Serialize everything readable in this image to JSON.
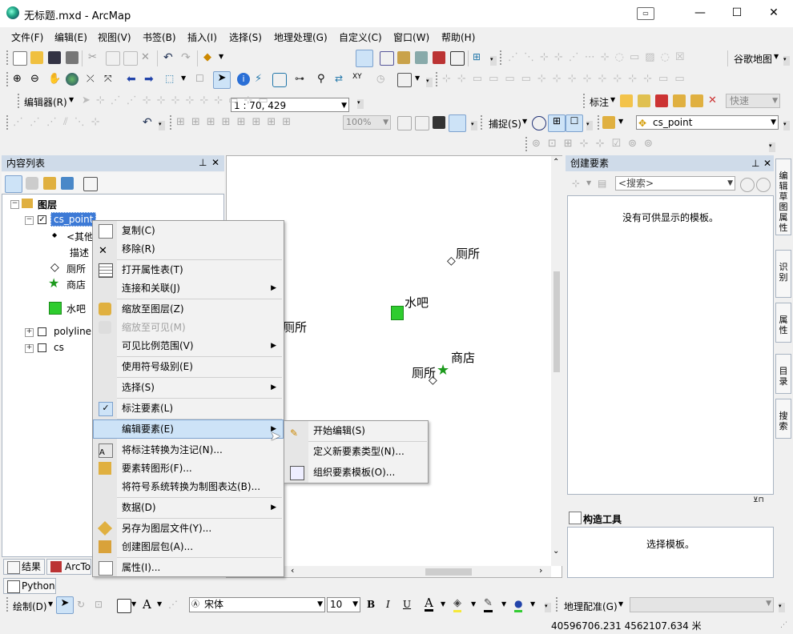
{
  "window": {
    "title": "无标题.mxd - ArcMap",
    "minimize": "—",
    "maximize": "☐",
    "close": "✕"
  },
  "menu": [
    "文件(F)",
    "编辑(E)",
    "视图(V)",
    "书签(B)",
    "插入(I)",
    "选择(S)",
    "地理处理(G)",
    "自定义(C)",
    "窗口(W)",
    "帮助(H)"
  ],
  "toolbar": {
    "scale": "1 : 70, 429",
    "basemap": "谷歌地图",
    "editor": "编辑器(R)",
    "label": "标注",
    "label_speed": "快速",
    "snapping": "捕捉(S)",
    "layer_select": "cs_point",
    "zoom_pct": "100%"
  },
  "toc": {
    "title": "内容列表",
    "pin": "ᵖ",
    "close": "✕",
    "root": "图层",
    "layers": [
      {
        "name": "cs_point",
        "checked": true,
        "expanded": true
      },
      {
        "name": "polyline",
        "checked": false,
        "expanded": false
      },
      {
        "name": "cs",
        "checked": false,
        "expanded": false
      }
    ],
    "legend": {
      "other": "<其他",
      "desc": "描述",
      "toilet": "厕所",
      "shop": "商店",
      "water": "水吧"
    }
  },
  "map": {
    "labels": {
      "toilet1": "厕所",
      "water": "水吧",
      "toilet2": "厕所",
      "shop": "商店",
      "toilet3": "厕所"
    }
  },
  "context_menu": {
    "items": [
      {
        "label": "复制(C)"
      },
      {
        "label": "移除(R)"
      },
      {
        "label": "打开属性表(T)"
      },
      {
        "label": "连接和关联(J)"
      },
      {
        "label": "缩放至图层(Z)"
      },
      {
        "label": "缩放至可见(M)"
      },
      {
        "label": "可见比例范围(V)"
      },
      {
        "label": "使用符号级别(E)"
      },
      {
        "label": "选择(S)"
      },
      {
        "label": "标注要素(L)"
      },
      {
        "label": "编辑要素(E)"
      },
      {
        "label": "将标注转换为注记(N)..."
      },
      {
        "label": "要素转图形(F)..."
      },
      {
        "label": "将符号系统转换为制图表达(B)..."
      },
      {
        "label": "数据(D)"
      },
      {
        "label": "另存为图层文件(Y)..."
      },
      {
        "label": "创建图层包(A)..."
      },
      {
        "label": "属性(I)..."
      }
    ],
    "submenu": [
      {
        "label": "开始编辑(S)"
      },
      {
        "label": "定义新要素类型(N)..."
      },
      {
        "label": "组织要素模板(O)..."
      }
    ]
  },
  "create_features": {
    "title": "创建要素",
    "search_placeholder": "<搜索>",
    "empty": "没有可供显示的模板。",
    "construct_title": "构造工具",
    "construct_empty": "选择模板。"
  },
  "side_tabs": [
    "编辑草图属性",
    "识别",
    "属性",
    "目录",
    "搜索"
  ],
  "bottom_tabs": {
    "results": "结果",
    "arctoolbox": "ArcTo",
    "python": "Python"
  },
  "draw_toolbar": {
    "draw": "绘制(D)",
    "font": "宋体",
    "size": "10",
    "bold": "B",
    "italic": "I",
    "underline": "U",
    "georef": "地理配准(G)"
  },
  "status": {
    "coords": "40596706.231   4562107.634 米"
  }
}
